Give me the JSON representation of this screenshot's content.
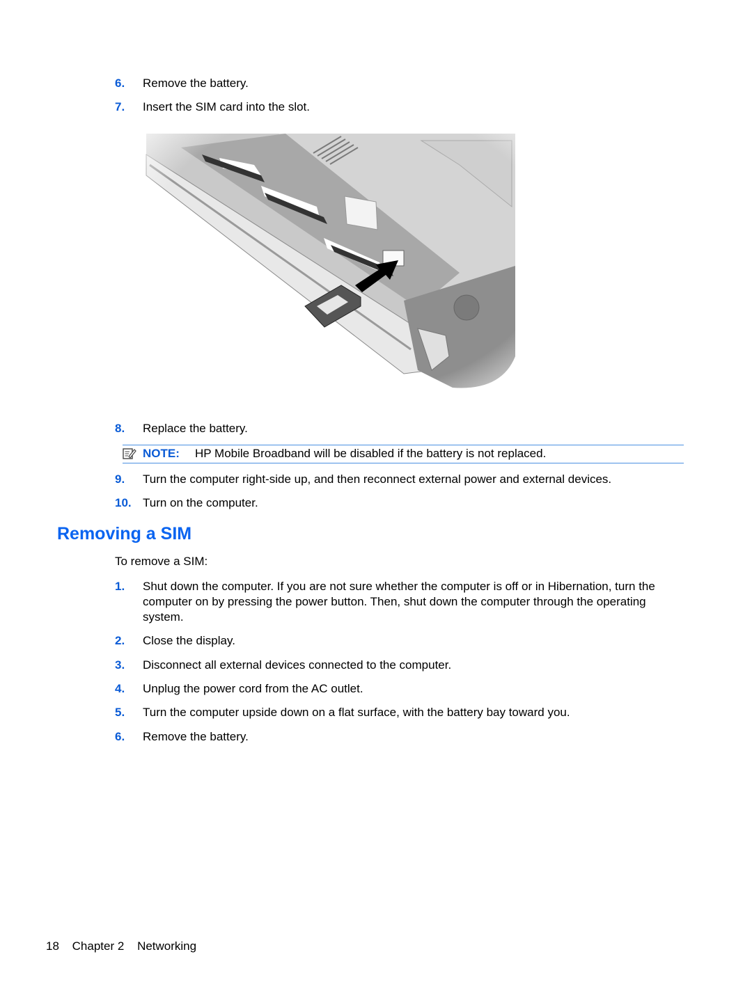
{
  "steps_top": [
    {
      "num": "6.",
      "text": "Remove the battery."
    },
    {
      "num": "7.",
      "text": "Insert the SIM card into the slot."
    }
  ],
  "figure": {
    "description": "Laptop underside with battery bay open; arrow pointing to SIM slot with SIM card being inserted"
  },
  "steps_mid": [
    {
      "num": "8.",
      "text": "Replace the battery."
    },
    {
      "num": "9.",
      "text": "Turn the computer right-side up, and then reconnect external power and external devices."
    },
    {
      "num": "10.",
      "text": "Turn on the computer."
    }
  ],
  "note": {
    "icon": "note-pencil-icon",
    "label": "NOTE:",
    "text": "HP Mobile Broadband will be disabled if the battery is not replaced."
  },
  "section": {
    "heading": "Removing a SIM",
    "intro": "To remove a SIM:",
    "steps": [
      {
        "num": "1.",
        "text": "Shut down the computer. If you are not sure whether the computer is off or in Hibernation, turn the computer on by pressing the power button. Then, shut down the computer through the operating system."
      },
      {
        "num": "2.",
        "text": "Close the display."
      },
      {
        "num": "3.",
        "text": "Disconnect all external devices connected to the computer."
      },
      {
        "num": "4.",
        "text": "Unplug the power cord from the AC outlet."
      },
      {
        "num": "5.",
        "text": "Turn the computer upside down on a flat surface, with the battery bay toward you."
      },
      {
        "num": "6.",
        "text": "Remove the battery."
      }
    ]
  },
  "footer": {
    "page": "18",
    "chapter": "Chapter 2",
    "title": "Networking"
  }
}
